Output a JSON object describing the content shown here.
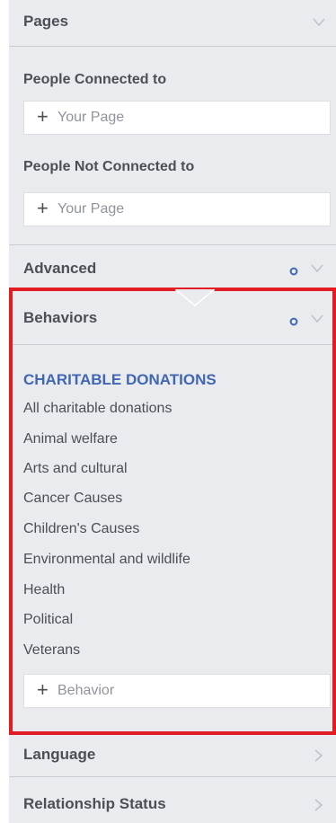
{
  "sections": {
    "pages": {
      "title": "Pages"
    },
    "connected": {
      "label": "People Connected to",
      "placeholder": "Your Page"
    },
    "not_connected": {
      "label": "People Not Connected to",
      "placeholder": "Your Page"
    },
    "advanced": {
      "title": "Advanced"
    },
    "behaviors": {
      "title": "Behaviors",
      "category": "CHARITABLE DONATIONS",
      "options": [
        "All charitable donations",
        "Animal welfare",
        "Arts and cultural",
        "Cancer Causes",
        "Children's Causes",
        "Environmental and wildlife",
        "Health",
        "Political",
        "Veterans"
      ],
      "input_placeholder": "Behavior"
    },
    "language": {
      "title": "Language"
    },
    "relationship": {
      "title": "Relationship Status"
    }
  },
  "icons": {
    "plus": "+",
    "expand": "chevron-down-icon",
    "collapsed": "chevron-right-icon",
    "active_dot": "blue-dot-icon"
  },
  "colors": {
    "panel_bg": "#e9ebee",
    "accent": "#4267b2",
    "highlight": "#e31b23",
    "text": "#4b4f56",
    "placeholder": "#90949c"
  }
}
